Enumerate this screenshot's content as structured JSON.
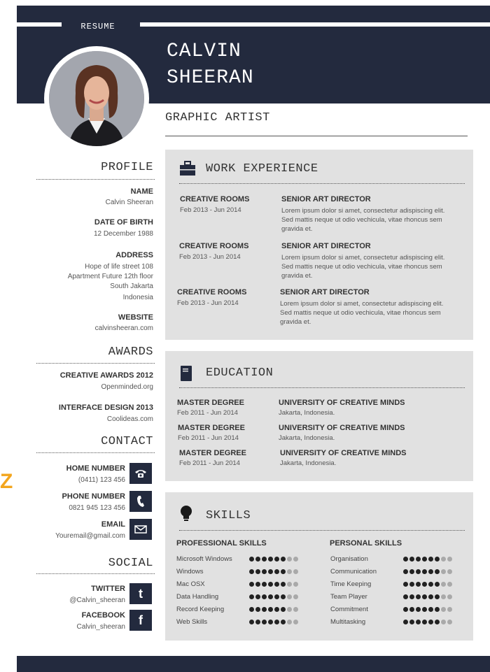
{
  "header": {
    "label": "RESUME",
    "first_name": "CALVIN",
    "last_name": "SHEERAN",
    "job_title": "GRAPHIC ARTIST"
  },
  "profile": {
    "heading": "PROFILE",
    "name_label": "NAME",
    "name_value": "Calvin Sheeran",
    "dob_label": "DATE OF BIRTH",
    "dob_value": "12 December 1988",
    "address_label": "ADDRESS",
    "address_lines": [
      "Hope of life street 108",
      "Apartment Future 12th floor",
      "South Jakarta",
      "Indonesia"
    ],
    "website_label": "WEBSITE",
    "website_value": "calvinsheeran.com"
  },
  "awards": {
    "heading": "AWARDS",
    "items": [
      {
        "title": "CREATIVE AWARDS 2012",
        "org": "Openminded.org"
      },
      {
        "title": "INTERFACE DESIGN 2013",
        "org": "Coolideas.com"
      }
    ]
  },
  "contact": {
    "heading": "CONTACT",
    "items": [
      {
        "label": "HOME NUMBER",
        "value": "(0411) 123 456",
        "icon": "telephone-icon"
      },
      {
        "label": "PHONE NUMBER",
        "value": "0821 945 123 456",
        "icon": "mobile-phone-icon"
      },
      {
        "label": "EMAIL",
        "value": "Youremail@gmail.com",
        "icon": "envelope-icon"
      }
    ]
  },
  "social": {
    "heading": "SOCIAL",
    "items": [
      {
        "label": "TWITTER",
        "value": "@Calvin_sheeran",
        "icon": "twitter-icon",
        "glyph": "t"
      },
      {
        "label": "FACEBOOK",
        "value": "Calvin_sheeran",
        "icon": "facebook-icon",
        "glyph": "f"
      }
    ]
  },
  "work": {
    "heading": "WORK EXPERIENCE",
    "items": [
      {
        "company": "CREATIVE ROOMS",
        "dates": "Feb 2013 - Jun 2014",
        "role": "SENIOR ART DIRECTOR",
        "desc": "Lorem ipsum dolor si amet, consectetur adispiscing elit. Sed mattis neque ut odio vechicula, vitae rhoncus sem gravida et."
      },
      {
        "company": "CREATIVE ROOMS",
        "dates": "Feb 2013 - Jun 2014",
        "role": "SENIOR ART DIRECTOR",
        "desc": "Lorem ipsum dolor si amet, consectetur adispiscing elit. Sed mattis neque ut odio vechicula, vitae rhoncus sem gravida et."
      },
      {
        "company": "CREATIVE ROOMS",
        "dates": "Feb 2013 - Jun 2014",
        "role": "SENIOR ART DIRECTOR",
        "desc": "Lorem ipsum dolor si amet, consectetur adispiscing elit. Sed mattis neque ut odio vechicula, vitae rhoncus sem gravida et."
      }
    ]
  },
  "education": {
    "heading": "EDUCATION",
    "items": [
      {
        "degree": "MASTER DEGREE",
        "dates": "Feb 2011 - Jun 2014",
        "school": "UNIVERSITY OF CREATIVE MINDS",
        "location": "Jakarta, Indonesia."
      },
      {
        "degree": "MASTER DEGREE",
        "dates": "Feb 2011 - Jun 2014",
        "school": "UNIVERSITY OF CREATIVE MINDS",
        "location": "Jakarta, Indonesia."
      },
      {
        "degree": "MASTER DEGREE",
        "dates": "Feb 2011 - Jun 2014",
        "school": "UNIVERSITY OF CREATIVE MINDS",
        "location": "Jakarta, Indonesia."
      }
    ]
  },
  "skills": {
    "heading": "SKILLS",
    "professional_heading": "PROFESSIONAL SKILLS",
    "personal_heading": "PERSONAL SKILLS",
    "max_level": 8,
    "professional": [
      {
        "name": "Microsoft Windows",
        "level": 6
      },
      {
        "name": "Windows",
        "level": 6
      },
      {
        "name": "Mac OSX",
        "level": 6
      },
      {
        "name": "Data Handling",
        "level": 6
      },
      {
        "name": "Record Keeping",
        "level": 6
      },
      {
        "name": "Web Skills",
        "level": 6
      }
    ],
    "personal": [
      {
        "name": "Organisation",
        "level": 6
      },
      {
        "name": "Communication",
        "level": 6
      },
      {
        "name": "Time Keeping",
        "level": 6
      },
      {
        "name": "Team Player",
        "level": 6
      },
      {
        "name": "Commitment",
        "level": 6
      },
      {
        "name": "Multitasking",
        "level": 6
      }
    ]
  },
  "watermark": "Z",
  "colors": {
    "navy": "#232a3e",
    "panel": "#e1e1e1",
    "accent": "#f3a51d"
  }
}
